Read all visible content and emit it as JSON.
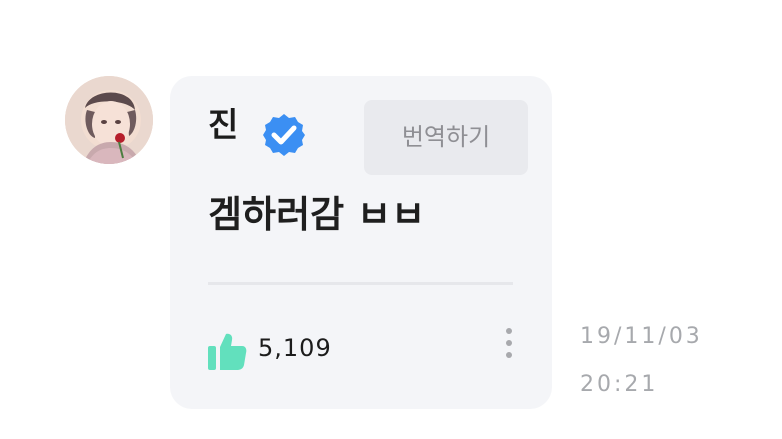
{
  "message": {
    "author": "진",
    "verified_icon": "verified-check-icon",
    "translate_label": "번역하기",
    "text": "겜하러감 ㅂㅂ",
    "like_icon": "thumbs-up-icon",
    "like_count": "5,109",
    "more_icon": "more-vertical-icon",
    "date": "19/11/03",
    "time": "20:21"
  },
  "colors": {
    "bubble": "#f4f5f8",
    "verified": "#3b8ff3",
    "like": "#62e0bd",
    "timestamp": "#a7a9ad"
  }
}
